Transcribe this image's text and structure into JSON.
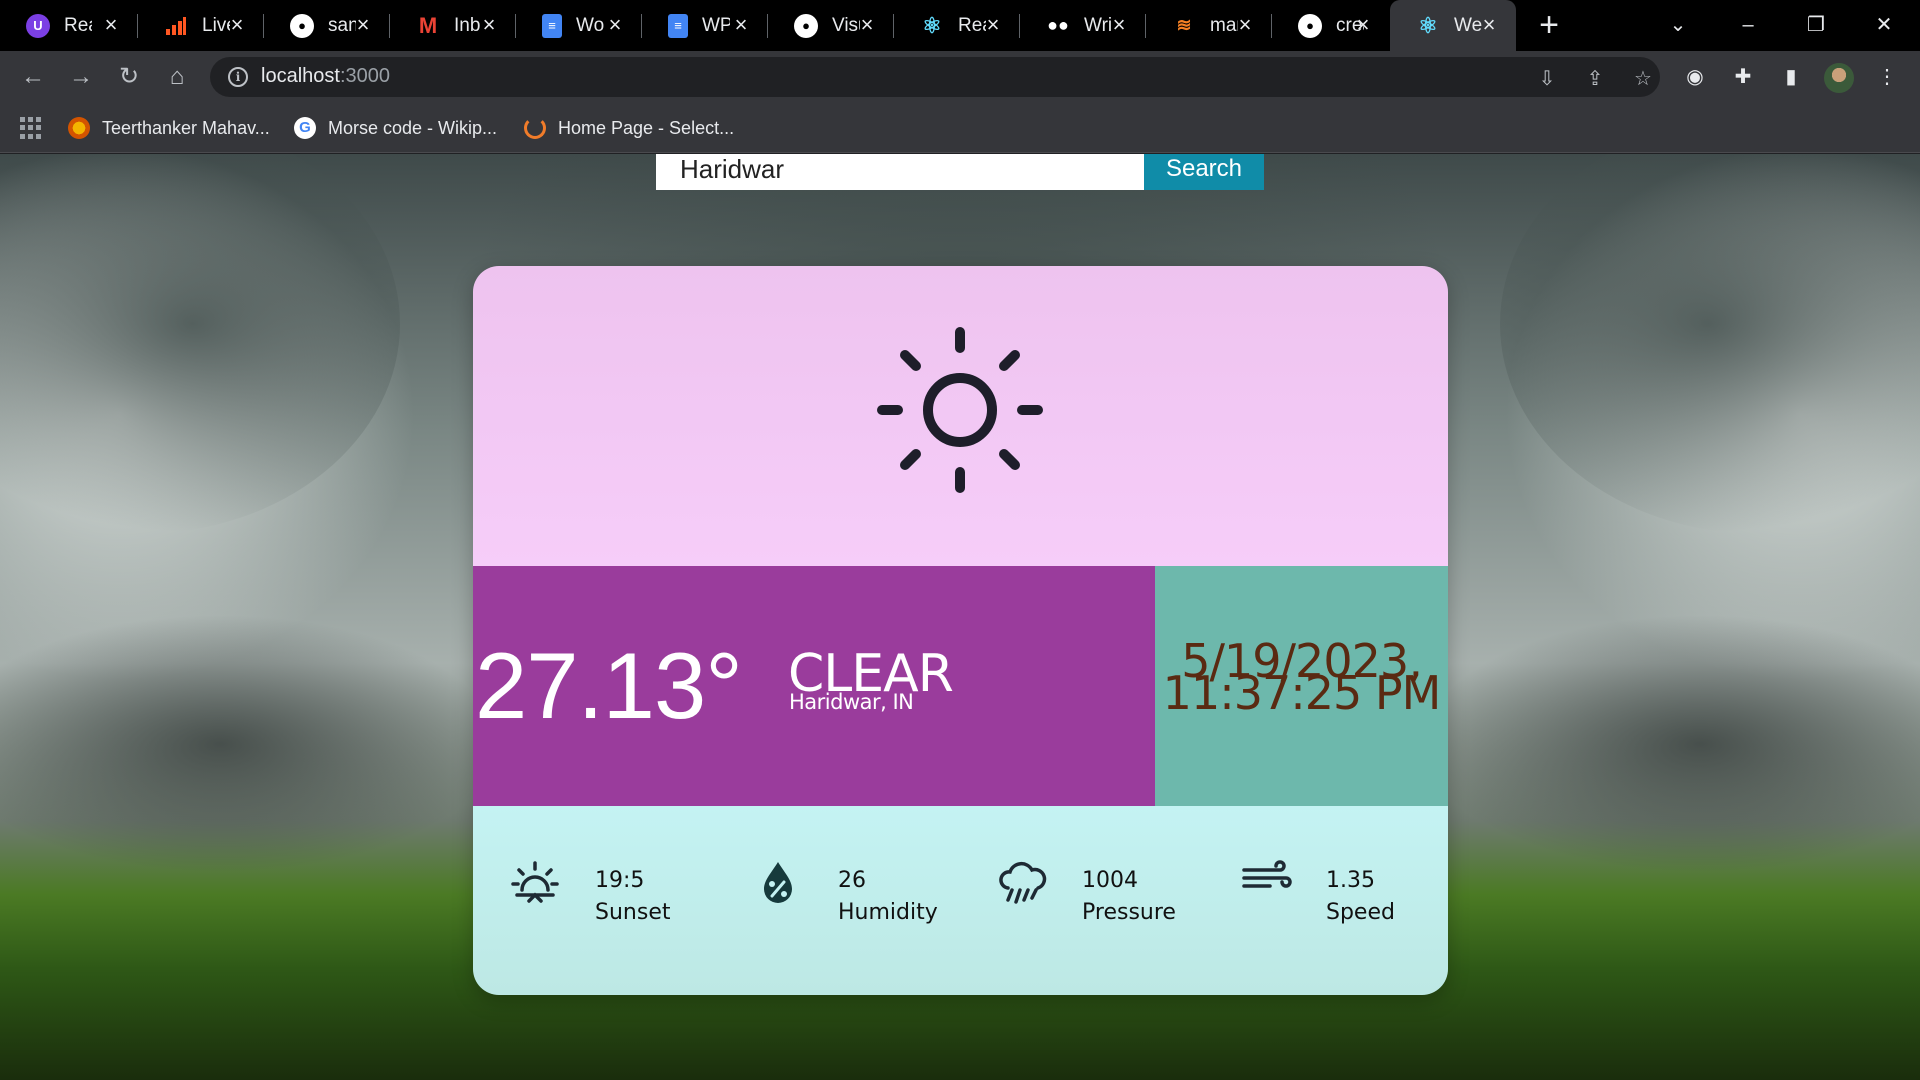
{
  "browser": {
    "tabs": [
      {
        "title": "Rea",
        "icon": "u-logo-icon",
        "color": "#7b3fe4"
      },
      {
        "title": "Live",
        "icon": "bars-logo-icon",
        "color": "#ff5722"
      },
      {
        "title": "san",
        "icon": "github-icon",
        "color": "#ffffff"
      },
      {
        "title": "Inb",
        "icon": "gmail-icon",
        "color": "#ea4335"
      },
      {
        "title": "Wo",
        "icon": "docs-icon",
        "color": "#4285f4"
      },
      {
        "title": "WP",
        "icon": "docs-icon",
        "color": "#4285f4"
      },
      {
        "title": "Visu",
        "icon": "github-icon",
        "color": "#ffffff"
      },
      {
        "title": "Rea",
        "icon": "react-icon",
        "color": "#61dafb"
      },
      {
        "title": "Wri",
        "icon": "medium-icon",
        "color": "#ffffff"
      },
      {
        "title": "mar",
        "icon": "stackoverflow-icon",
        "color": "#f48024"
      },
      {
        "title": "crea",
        "icon": "github-icon",
        "color": "#ffffff"
      },
      {
        "title": "We",
        "icon": "react-icon",
        "color": "#61dafb",
        "active": true
      }
    ],
    "address": {
      "host": "localhost",
      "port": ":3000"
    },
    "bookmarks": [
      {
        "label": "Teerthanker Mahav...",
        "icon": "university-icon"
      },
      {
        "label": "Morse code - Wikip...",
        "icon": "google-icon"
      },
      {
        "label": "Home Page - Select...",
        "icon": "selectcode-icon"
      }
    ]
  },
  "app": {
    "search": {
      "value": "Haridwar",
      "button_label": "Search"
    },
    "weather": {
      "icon": "sun-icon",
      "temperature": "27.13°",
      "condition": "CLEAR",
      "location": "Haridwar, IN",
      "date": "5/19/2023,",
      "time": "11:37:25 PM"
    },
    "stats": [
      {
        "icon": "sunset-icon",
        "value": "19:5",
        "label": "Sunset"
      },
      {
        "icon": "humidity-icon",
        "value": "26",
        "label": "Humidity"
      },
      {
        "icon": "rain-cloud-icon",
        "value": "1004",
        "label": "Pressure"
      },
      {
        "icon": "wind-icon",
        "value": "1.35",
        "label": "Speed"
      }
    ],
    "colors": {
      "card_top": "#f6cdf9",
      "temp_panel": "#9a3c9c",
      "date_panel": "#6db8ac",
      "date_text": "#5a2a12",
      "stats_panel": "#c4f3f3",
      "search_button": "#108ca8"
    }
  }
}
